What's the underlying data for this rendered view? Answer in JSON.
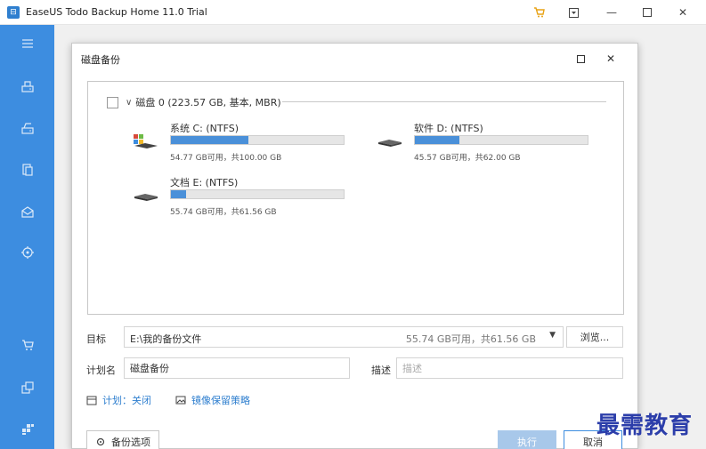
{
  "app": {
    "title": "EaseUS Todo Backup Home 11.0 Trial",
    "logo_icon": "easeus-logo"
  },
  "window_controls": [
    "cart-icon",
    "menu-icon",
    "minimize-icon",
    "maximize-icon",
    "close-icon"
  ],
  "sidebar": {
    "color": "#3d8de0",
    "items": [
      {
        "icon": "hamburger-menu-icon"
      },
      {
        "icon": "disk-backup-icon"
      },
      {
        "icon": "system-backup-icon"
      },
      {
        "icon": "file-backup-icon"
      },
      {
        "icon": "mail-backup-icon"
      },
      {
        "icon": "smart-backup-icon"
      },
      {
        "icon": "cart-icon"
      },
      {
        "icon": "clone-icon"
      },
      {
        "icon": "tools-icon"
      }
    ]
  },
  "dialog": {
    "title": "磁盘备份",
    "disk": {
      "label": "磁盘 0 (223.57 GB, 基本, MBR)",
      "partitions": [
        {
          "name": "系统 C: (NTFS)",
          "info": "54.77 GB可用，共100.00 GB",
          "used_fraction": 0.45,
          "os": true
        },
        {
          "name": "软件 D: (NTFS)",
          "info": "45.57 GB可用，共62.00 GB",
          "used_fraction": 0.26,
          "os": false
        },
        {
          "name": "文档 E: (NTFS)",
          "info": "55.74 GB可用，共61.56 GB",
          "used_fraction": 0.09,
          "os": false
        }
      ]
    },
    "target": {
      "label": "目标",
      "path": "E:\\我的备份文件",
      "info": "55.74 GB可用，共61.56 GB",
      "browse_label": "浏览..."
    },
    "plan_name": {
      "label": "计划名",
      "value": "磁盘备份"
    },
    "description": {
      "label": "描述",
      "placeholder": "描述"
    },
    "schedule_link": "计划：关闭",
    "image_reserve_link": "镜像保留策略",
    "buttons": {
      "options": "备份选项",
      "execute": "执行",
      "cancel": "取消"
    }
  },
  "watermark": "最需教育"
}
